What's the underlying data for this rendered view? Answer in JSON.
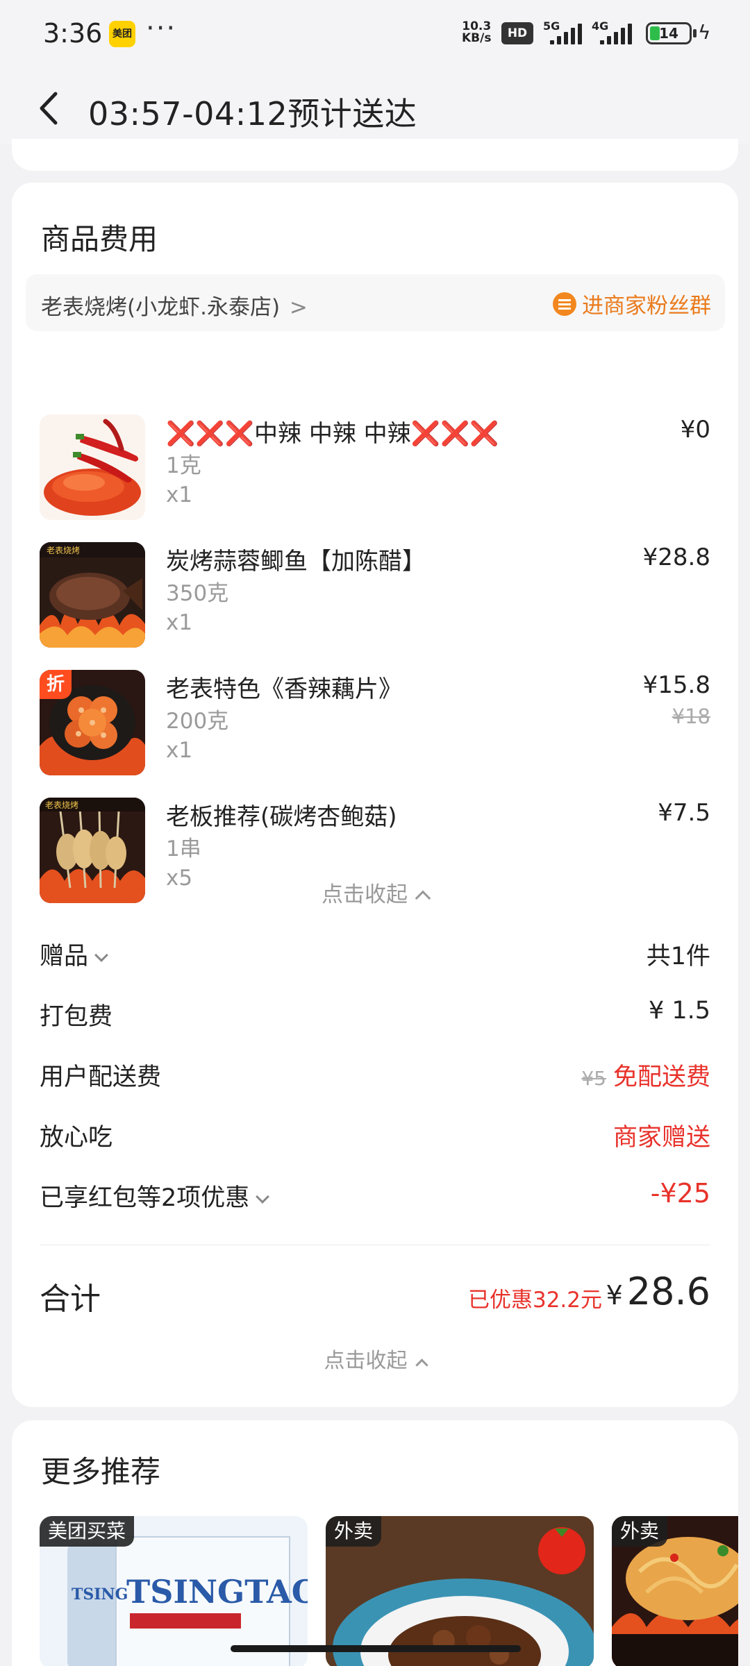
{
  "status_bar": {
    "time": "3:36",
    "app_badge": "美团",
    "dots": "···",
    "net_speed_value": "10.3",
    "net_speed_unit": "KB/s",
    "hd": "HD",
    "sig1": "5G",
    "sig2": "4G",
    "battery": "14"
  },
  "header": {
    "title": "03:57-04:12预计送达"
  },
  "fees_section": {
    "title": "商品费用",
    "shop_name": "老表烧烤(小龙虾.永泰店)",
    "shop_chevron": ">",
    "fan_group": "进商家粉丝群",
    "items": [
      {
        "name_mark_left": "❌❌❌",
        "name_core": "中辣 中辣 中辣",
        "name_mark_right": "❌❌❌",
        "spec": "1克",
        "qty": "x1",
        "price": "¥0",
        "original_price": ""
      },
      {
        "name": "炭烤蒜蓉鲫鱼【加陈醋】",
        "spec": "350克",
        "qty": "x1",
        "price": "¥28.8",
        "original_price": ""
      },
      {
        "name": "老表特色《香辣藕片》",
        "spec": "200克",
        "qty": "x1",
        "price": "¥15.8",
        "original_price": "¥18",
        "badge": "折"
      },
      {
        "name": "老板推荐(碳烤杏鲍菇)",
        "spec": "1串",
        "qty": "x5",
        "price": "¥7.5",
        "original_price": ""
      }
    ],
    "collapse_label": "点击收起",
    "rows": [
      {
        "label": "赠品",
        "value": "共1件"
      },
      {
        "label": "打包费",
        "value": "¥ 1.5"
      },
      {
        "label": "用户配送费",
        "strike": "¥5",
        "value": "免配送费"
      },
      {
        "label": "放心吃",
        "value": "商家赠送"
      },
      {
        "label": "已享红包等2项优惠",
        "value": "-¥25"
      }
    ],
    "total_label": "合计",
    "total_saved": "已优惠32.2元",
    "total_yen": "¥",
    "total_amount": "28.6",
    "collapse_label_2": "点击收起"
  },
  "recommend": {
    "title": "更多推荐",
    "cards": [
      {
        "tag": "美团买菜"
      },
      {
        "tag": "外卖"
      },
      {
        "tag": "外卖"
      }
    ],
    "beer_brand": "TSINGTAO"
  }
}
